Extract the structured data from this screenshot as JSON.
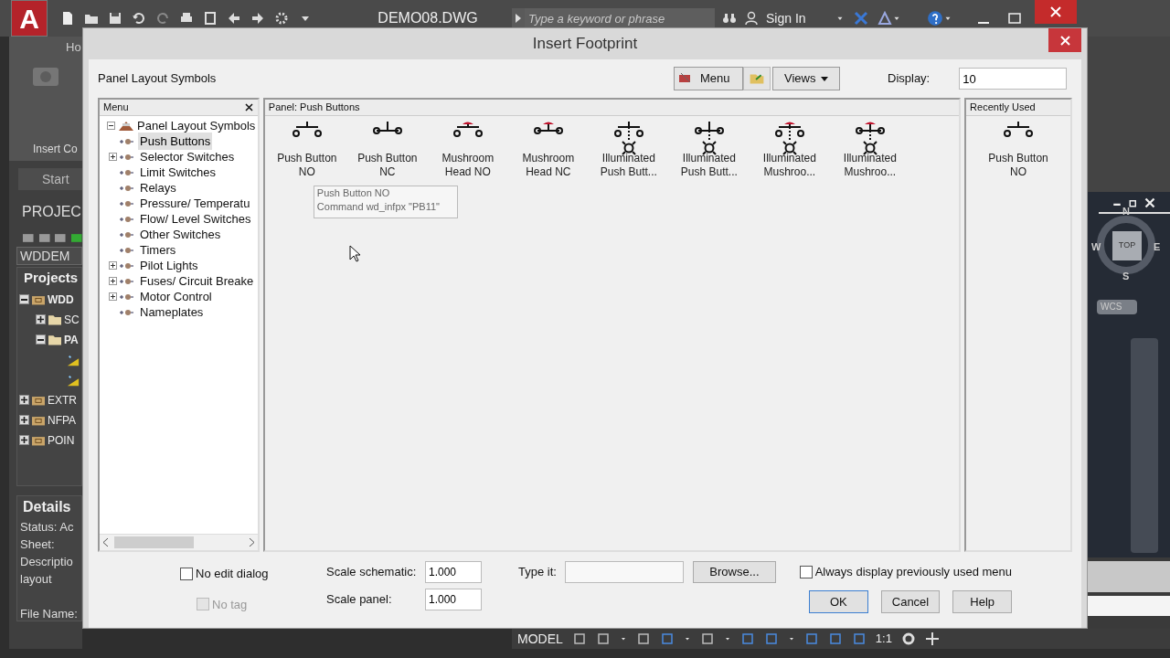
{
  "app": {
    "logo_letter": "A",
    "file_name": "DEMO08.DWG",
    "search": {
      "placeholder": "Type a keyword or phrase"
    },
    "sign_in": "Sign In"
  },
  "left_panel": {
    "ribbon_tab": "Ho",
    "ribbon_label": "Insert Co",
    "start_tab": "Start",
    "header": "PROJEC",
    "project_field": "WDDEM",
    "projects_title": "Projects",
    "tree": [
      {
        "label": "WDD",
        "kind": "project",
        "expanded": true,
        "children": [
          {
            "label": "SC",
            "kind": "folder",
            "expanded": false
          },
          {
            "label": "PA",
            "kind": "folder",
            "expanded": true,
            "children": [
              {
                "kind": "drawing"
              },
              {
                "kind": "drawing"
              }
            ]
          }
        ]
      },
      {
        "label": "EXTR",
        "kind": "project",
        "expanded": false
      },
      {
        "label": "NFPA",
        "kind": "project",
        "expanded": false
      },
      {
        "label": "POIN",
        "kind": "project",
        "expanded": false
      }
    ],
    "details_title": "Details",
    "details_lines": [
      "Status: Ac",
      "Sheet:",
      "Descriptio",
      "layout",
      "File Name:"
    ]
  },
  "viewcube": {
    "north": "N",
    "east": "E",
    "south": "S",
    "west": "W",
    "face": "TOP",
    "ucs": "WCS"
  },
  "status_bar": {
    "model": "MODEL",
    "scale": "1:1"
  },
  "dialog": {
    "title": "Insert Footprint",
    "header": "Panel Layout Symbols",
    "menu_button": "Menu",
    "views_button": "Views",
    "display_label": "Display:",
    "display_value": "10",
    "menu_pane": {
      "title": "Menu",
      "root": {
        "label": "Panel Layout Symbols",
        "expanded": true,
        "children": [
          {
            "label": "Push Buttons",
            "expandable": false,
            "selected": true
          },
          {
            "label": "Selector Switches",
            "expandable": true,
            "selected": false
          },
          {
            "label": "Limit Switches",
            "expandable": false,
            "selected": false
          },
          {
            "label": "Relays",
            "expandable": false,
            "selected": false
          },
          {
            "label": "Pressure/ Temperatu",
            "expandable": false,
            "selected": false
          },
          {
            "label": "Flow/ Level Switches",
            "expandable": false,
            "selected": false
          },
          {
            "label": "Other Switches",
            "expandable": false,
            "selected": false
          },
          {
            "label": "Timers",
            "expandable": false,
            "selected": false
          },
          {
            "label": "Pilot Lights",
            "expandable": true,
            "selected": false
          },
          {
            "label": "Fuses/ Circuit Breake",
            "expandable": true,
            "selected": false
          },
          {
            "label": "Motor Control",
            "expandable": true,
            "selected": false
          },
          {
            "label": "Nameplates",
            "expandable": false,
            "selected": false
          }
        ]
      }
    },
    "symbol_pane": {
      "title": "Panel: Push Buttons",
      "symbols": [
        {
          "label": "Push Button\nNO",
          "kind": "pb_no"
        },
        {
          "label": "Push Button\nNC",
          "kind": "pb_nc"
        },
        {
          "label": "Mushroom\nHead NO",
          "kind": "mush_no"
        },
        {
          "label": "Mushroom\nHead NC",
          "kind": "mush_nc"
        },
        {
          "label": "Illuminated\nPush Butt...",
          "kind": "lit_pb_no"
        },
        {
          "label": "Illuminated\nPush Butt...",
          "kind": "lit_pb_nc"
        },
        {
          "label": "Illuminated\nMushroo...",
          "kind": "lit_mush_no"
        },
        {
          "label": "Illuminated\nMushroo...",
          "kind": "lit_mush_nc"
        }
      ],
      "tooltip": {
        "title": "Push Button NO",
        "command": "Command wd_infpx \"PB11\""
      }
    },
    "recent_pane": {
      "title": "Recently Used",
      "symbols": [
        {
          "label": "Push Button\nNO",
          "kind": "pb_no"
        }
      ]
    },
    "options": {
      "no_edit_dialog": {
        "label": "No edit dialog",
        "checked": false,
        "disabled": false
      },
      "no_tag": {
        "label": "No tag",
        "checked": false,
        "disabled": true
      },
      "scale_schematic_label": "Scale schematic:",
      "scale_schematic": "1.000",
      "scale_panel_label": "Scale panel:",
      "scale_panel": "1.000",
      "type_it_label": "Type it:",
      "browse": "Browse...",
      "always_display": {
        "label": "Always display previously used menu",
        "checked": false,
        "disabled": false
      }
    },
    "buttons": [
      "OK",
      "Cancel",
      "Help"
    ]
  }
}
